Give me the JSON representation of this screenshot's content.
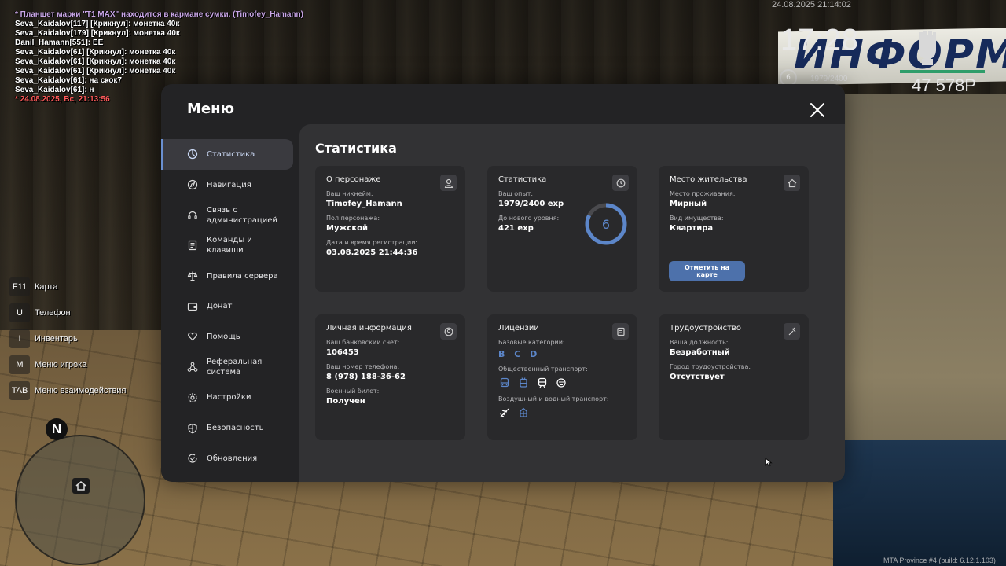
{
  "chat": [
    {
      "text": "* Планшет марки \"T1 MAX\" находится в кармане сумки. (Timofey_Hamann)",
      "color": "#c9a6e6"
    },
    {
      "text": "Seva_Kaidalov[117] [Крикнул]: монетка 40к",
      "color": "#ffffff"
    },
    {
      "text": "Seva_Kaidalov[179] [Крикнул]: монетка 40к",
      "color": "#ffffff"
    },
    {
      "text": "Danil_Hamann[551]: ЕЕ",
      "color": "#ffffff"
    },
    {
      "text": "Seva_Kaidalov[61] [Крикнул]: монетка 40к",
      "color": "#ffffff"
    },
    {
      "text": "Seva_Kaidalov[61] [Крикнул]: монетка 40к",
      "color": "#ffffff"
    },
    {
      "text": "Seva_Kaidalov[61] [Крикнул]: монетка 40к",
      "color": "#ffffff"
    },
    {
      "text": "Seva_Kaidalov[61]: на скок7",
      "color": "#ffffff"
    },
    {
      "text": "Seva_Kaidalov[61]: н",
      "color": "#ffffff"
    },
    {
      "text": "* 24.08.2025, Вс, 21:13:56",
      "color": "#ff5a5a"
    }
  ],
  "hud": {
    "date": "24.08.2025 21:14:02",
    "time": "17:28",
    "level": "6",
    "exp": "1979/2400",
    "money": "47 578Р",
    "sign_text": "ИНФОРМА"
  },
  "keybinds": [
    {
      "key": "F11",
      "label": "Карта"
    },
    {
      "key": "U",
      "label": "Телефон"
    },
    {
      "key": "I",
      "label": "Инвентарь"
    },
    {
      "key": "M",
      "label": "Меню игрока"
    },
    {
      "key": "TAB",
      "label": "Меню взаимодействия"
    }
  ],
  "minimap": {
    "compass": "N"
  },
  "menu": {
    "title": "Меню",
    "nav": [
      {
        "label": "Статистика",
        "icon": "pie-chart-icon",
        "active": true
      },
      {
        "label": "Навигация",
        "icon": "compass-icon"
      },
      {
        "label": "Связь с администрацией",
        "icon": "headset-icon"
      },
      {
        "label": "Команды и клавиши",
        "icon": "document-icon"
      },
      {
        "label": "Правила сервера",
        "icon": "scales-icon"
      },
      {
        "label": "Донат",
        "icon": "wallet-icon"
      },
      {
        "label": "Помощь",
        "icon": "heart-hands-icon"
      },
      {
        "label": "Реферальная система",
        "icon": "network-icon"
      },
      {
        "label": "Настройки",
        "icon": "gear-icon"
      },
      {
        "label": "Безопасность",
        "icon": "shield-icon"
      },
      {
        "label": "Обновления",
        "icon": "refresh-check-icon"
      }
    ],
    "content_title": "Статистика",
    "character": {
      "title": "О персонаже",
      "nickname_label": "Ваш никнейм:",
      "nickname": "Timofey_Hamann",
      "gender_label": "Пол персонажа:",
      "gender": "Мужской",
      "reg_label": "Дата и время регистрации:",
      "reg": "03.08.2025 21:44:36"
    },
    "stats": {
      "title": "Статистика",
      "exp_label": "Ваш опыт:",
      "exp": "1979/2400 exp",
      "next_label": "До нового уровня:",
      "next": "421 exp",
      "level": "6",
      "progress": 0.8246
    },
    "residence": {
      "title": "Место жительства",
      "place_label": "Место проживания:",
      "place": "Мирный",
      "property_label": "Вид имущества:",
      "property": "Квартира",
      "button": "Отметить на карте"
    },
    "personal": {
      "title": "Личная информация",
      "bank_label": "Ваш банковский счет:",
      "bank": "106453",
      "phone_label": "Ваш номер телефона:",
      "phone": "8 (978) 188-36-62",
      "military_label": "Военный билет:",
      "military": "Получен"
    },
    "licenses": {
      "title": "Лицензии",
      "basic_label": "Базовые категории:",
      "basic": "B C D",
      "public_label": "Общественный транспорт:",
      "air_label": "Воздушный и водный транспорт:"
    },
    "employment": {
      "title": "Трудоустройство",
      "position_label": "Ваша должность:",
      "position": "Безработный",
      "city_label": "Город трудоустройства:",
      "city": "Отсутствует"
    }
  },
  "build": "MTA Province #4 (build: 6.12.1.103)",
  "colors": {
    "accent": "#5c86c9",
    "button": "#4d71ab"
  }
}
